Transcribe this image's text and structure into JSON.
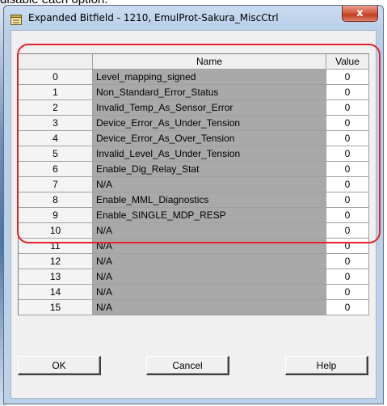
{
  "background_text": "disable each option.",
  "window": {
    "title": "Expanded Bitfield - 1210, EmulProt-Sakura_MiscCtrl",
    "close_label": "x"
  },
  "table": {
    "columns": [
      "",
      "Name",
      "Value"
    ],
    "rows": [
      {
        "index": "0",
        "name": "Level_mapping_signed",
        "value": "0"
      },
      {
        "index": "1",
        "name": "Non_Standard_Error_Status",
        "value": "0"
      },
      {
        "index": "2",
        "name": "Invalid_Temp_As_Sensor_Error",
        "value": "0"
      },
      {
        "index": "3",
        "name": "Device_Error_As_Under_Tension",
        "value": "0"
      },
      {
        "index": "4",
        "name": "Device_Error_As_Over_Tension",
        "value": "0"
      },
      {
        "index": "5",
        "name": "Invalid_Level_As_Under_Tension",
        "value": "0"
      },
      {
        "index": "6",
        "name": "Enable_Dig_Relay_Stat",
        "value": "0"
      },
      {
        "index": "7",
        "name": "N/A",
        "value": "0"
      },
      {
        "index": "8",
        "name": "Enable_MML_Diagnostics",
        "value": "0"
      },
      {
        "index": "9",
        "name": "Enable_SINGLE_MDP_RESP",
        "value": "0"
      },
      {
        "index": "10",
        "name": "N/A",
        "value": "0"
      },
      {
        "index": "11",
        "name": "N/A",
        "value": "0"
      },
      {
        "index": "12",
        "name": "N/A",
        "value": "0"
      },
      {
        "index": "13",
        "name": "N/A",
        "value": "0"
      },
      {
        "index": "14",
        "name": "N/A",
        "value": "0"
      },
      {
        "index": "15",
        "name": "N/A",
        "value": "0"
      }
    ]
  },
  "buttons": {
    "ok": "OK",
    "cancel": "Cancel",
    "help": "Help"
  },
  "colors": {
    "highlight": "#e8202a",
    "name_cell": "#a9a9a9"
  }
}
